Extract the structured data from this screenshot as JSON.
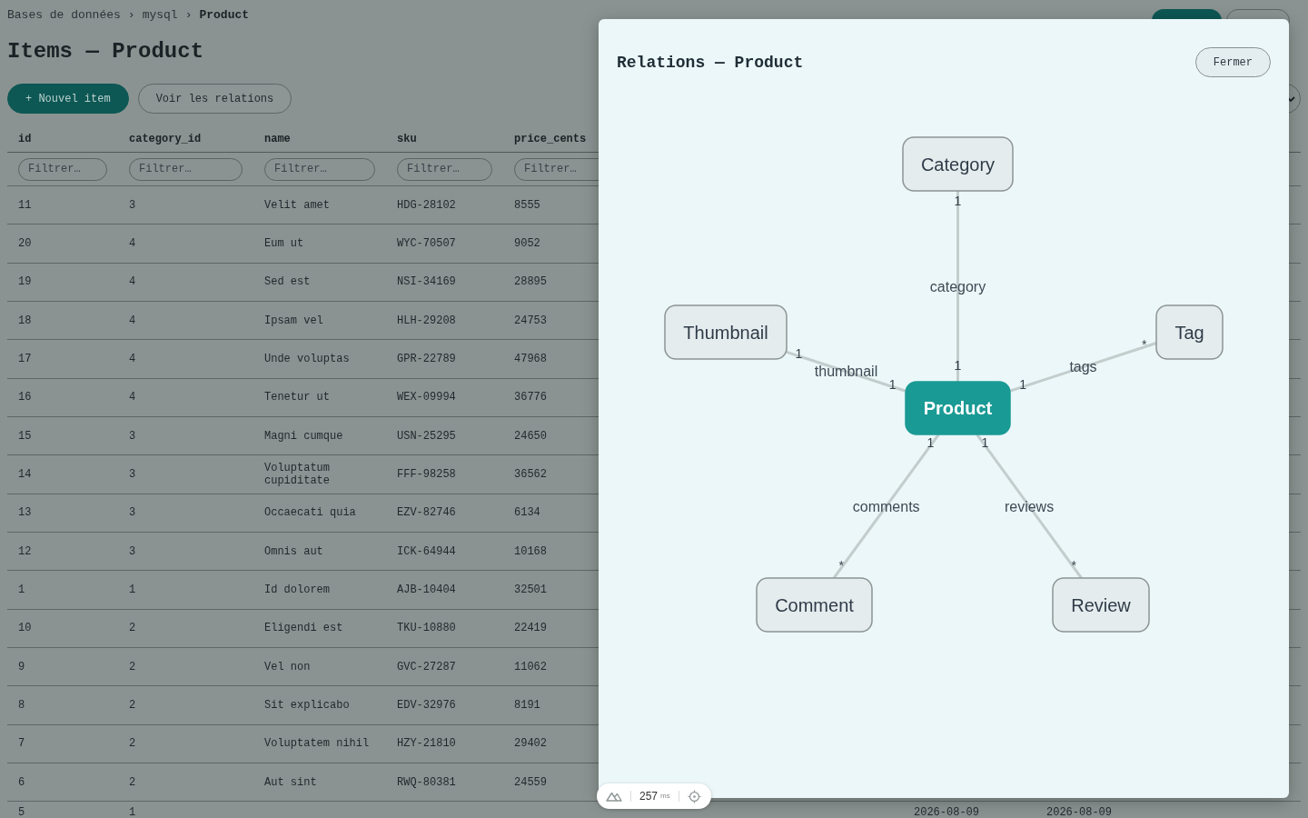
{
  "breadcrumb": [
    {
      "label": "Bases de données",
      "separator": "›",
      "current": false
    },
    {
      "label": "mysql",
      "separator": "›",
      "current": false
    },
    {
      "label": "Product",
      "current": true
    }
  ],
  "title": "Items — Product",
  "actions": [
    {
      "label": "+ Nouvel item",
      "kind": "primary"
    },
    {
      "label": "Voir les relations",
      "kind": "secondary"
    }
  ],
  "table": {
    "columns": [
      {
        "label": "id",
        "filter_placeholder": "Filtrer…"
      },
      {
        "label": "category_id",
        "filter_placeholder": "Filtrer…"
      },
      {
        "label": "name",
        "filter_placeholder": "Filtrer…"
      },
      {
        "label": "sku",
        "filter_placeholder": "Filtrer…"
      },
      {
        "label": "price_cents",
        "filter_placeholder": "Filtrer…"
      }
    ],
    "rows": [
      {
        "cells": [
          "11",
          "3",
          "Velit amet",
          "HDG-28102",
          "8555"
        ]
      },
      {
        "cells": [
          "20",
          "4",
          "Eum ut",
          "WYC-70507",
          "9052"
        ]
      },
      {
        "cells": [
          "19",
          "4",
          "Sed est",
          "NSI-34169",
          "28895"
        ]
      },
      {
        "cells": [
          "18",
          "4",
          "Ipsam vel",
          "HLH-29208",
          "24753"
        ]
      },
      {
        "cells": [
          "17",
          "4",
          "Unde voluptas",
          "GPR-22789",
          "47968"
        ]
      },
      {
        "cells": [
          "16",
          "4",
          "Tenetur ut",
          "WEX-09994",
          "36776"
        ]
      },
      {
        "cells": [
          "15",
          "3",
          "Magni cumque",
          "USN-25295",
          "24650"
        ]
      },
      {
        "cells": [
          "14",
          "3",
          "Voluptatum cupiditate",
          "FFF-98258",
          "36562"
        ]
      },
      {
        "cells": [
          "13",
          "3",
          "Occaecati quia",
          "EZV-82746",
          "6134"
        ]
      },
      {
        "cells": [
          "12",
          "3",
          "Omnis aut",
          "ICK-64944",
          "10168"
        ]
      },
      {
        "cells": [
          "1",
          "1",
          "Id dolorem",
          "AJB-10404",
          "32501"
        ]
      },
      {
        "cells": [
          "10",
          "2",
          "Eligendi est",
          "TKU-10880",
          "22419"
        ]
      },
      {
        "cells": [
          "9",
          "2",
          "Vel non",
          "GVC-27287",
          "11062"
        ]
      },
      {
        "cells": [
          "8",
          "2",
          "Sit explicabo",
          "EDV-32976",
          "8191"
        ]
      },
      {
        "cells": [
          "7",
          "2",
          "Voluptatem nihil",
          "HZY-21810",
          "29402"
        ]
      },
      {
        "cells": [
          "6",
          "2",
          "Aut sint",
          "RWQ-80381",
          "24559"
        ]
      },
      {
        "cells": [
          "5",
          "1"
        ],
        "trailing_cells": [
          "2026-08-09",
          "2026-08-09"
        ]
      }
    ]
  },
  "modal": {
    "title": "Relations — Product",
    "close_label": "Fermer",
    "graph": {
      "nodes": [
        {
          "label": "Category",
          "kind": "related",
          "relation": {
            "label": "category",
            "center_cardinality": "1",
            "node_cardinality": "1"
          }
        },
        {
          "label": "Thumbnail",
          "kind": "related",
          "relation": {
            "label": "thumbnail",
            "center_cardinality": "1",
            "node_cardinality": "1"
          }
        },
        {
          "label": "Tag",
          "kind": "related",
          "relation": {
            "label": "tags",
            "center_cardinality": "1",
            "node_cardinality": "*"
          }
        },
        {
          "label": "Product",
          "kind": "center"
        },
        {
          "label": "Comment",
          "kind": "related",
          "relation": {
            "label": "comments",
            "center_cardinality": "1",
            "node_cardinality": "*"
          }
        },
        {
          "label": "Review",
          "kind": "related",
          "relation": {
            "label": "reviews",
            "center_cardinality": "1",
            "node_cardinality": "*"
          }
        }
      ]
    }
  },
  "devtools": {
    "duration": "257",
    "unit": "ms"
  }
}
